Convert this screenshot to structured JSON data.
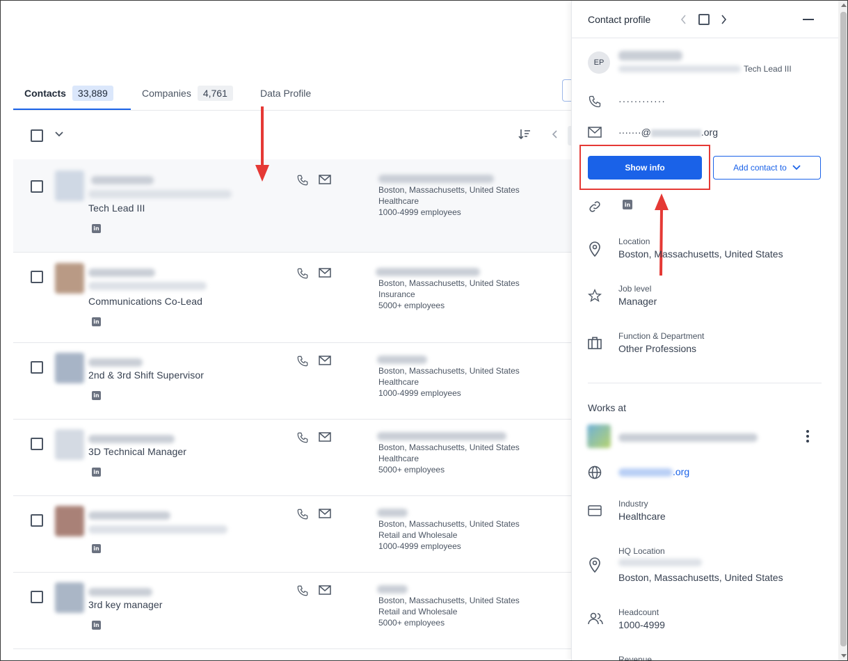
{
  "tabs": [
    {
      "label": "Contacts",
      "count": "33,889",
      "active": true
    },
    {
      "label": "Companies",
      "count": "4,761",
      "active": false
    },
    {
      "label": "Data Profile",
      "count": "",
      "active": false
    }
  ],
  "rows": [
    {
      "title": "Tech Lead III",
      "location": "Boston, Massachusetts, United States",
      "industry": "Healthcare",
      "size": "1000-4999 employees"
    },
    {
      "title": "Communications Co-Lead",
      "location": "Boston, Massachusetts, United States",
      "industry": "Insurance",
      "size": "5000+ employees"
    },
    {
      "title": "2nd & 3rd Shift Supervisor",
      "location": "Boston, Massachusetts, United States",
      "industry": "Healthcare",
      "size": "1000-4999 employees"
    },
    {
      "title": "3D Technical Manager",
      "location": "Boston, Massachusetts, United States",
      "industry": "Healthcare",
      "size": "5000+ employees"
    },
    {
      "title": "",
      "location": "Boston, Massachusetts, United States",
      "industry": "Retail and Wholesale",
      "size": "1000-4999 employees"
    },
    {
      "title": "3rd key manager",
      "location": "Boston, Massachusetts, United States",
      "industry": "Retail and Wholesale",
      "size": "5000+ employees"
    }
  ],
  "panel": {
    "title": "Contact profile",
    "initials": "EP",
    "job_title": "Tech Lead III",
    "phone": "············",
    "email_prefix": "·······@",
    "email_suffix": ".org",
    "show_info": "Show info",
    "add_contact": "Add contact to",
    "location_label": "Location",
    "location_value": "Boston, Massachusetts, United States",
    "job_level_label": "Job level",
    "job_level_value": "Manager",
    "function_label": "Function & Department",
    "function_value": "Other Professions",
    "works_at": "Works at",
    "website_suffix": ".org",
    "industry_label": "Industry",
    "industry_value": "Healthcare",
    "hq_label": "HQ Location",
    "hq_value": "Boston, Massachusetts, United States",
    "headcount_label": "Headcount",
    "headcount_value": "1000-4999",
    "revenue_label": "Revenue"
  },
  "colors": {
    "accent": "#1a62e8",
    "annotation": "#e53935"
  }
}
